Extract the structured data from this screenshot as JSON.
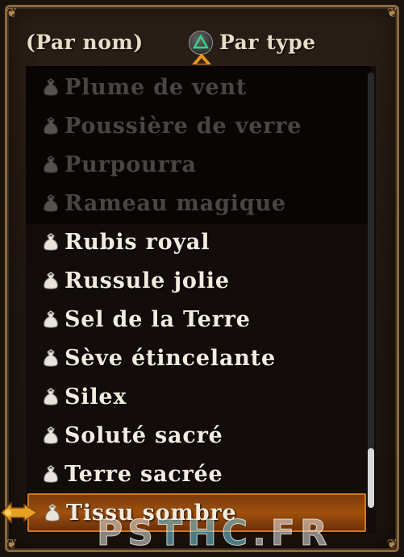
{
  "header": {
    "sort_by_name": "(Par nom)",
    "sort_by_type": "Par type",
    "button_icon": "triangle-button-icon"
  },
  "items": [
    {
      "label": "Plume de vent",
      "state": "dim"
    },
    {
      "label": "Poussière de verre",
      "state": "dim"
    },
    {
      "label": "Purpourra",
      "state": "dim"
    },
    {
      "label": "Rameau magique",
      "state": "dim"
    },
    {
      "label": "Rubis royal",
      "state": "normal"
    },
    {
      "label": "Russule jolie",
      "state": "normal"
    },
    {
      "label": "Sel de la Terre",
      "state": "normal"
    },
    {
      "label": "Sève étincelante",
      "state": "normal"
    },
    {
      "label": "Silex",
      "state": "normal"
    },
    {
      "label": "Soluté sacré",
      "state": "normal"
    },
    {
      "label": "Terre sacrée",
      "state": "normal"
    },
    {
      "label": "Tissu sombre",
      "state": "selected"
    }
  ],
  "watermark": {
    "left": "PS",
    "mid": "THC",
    "right": ".FR"
  },
  "colors": {
    "accent": "#e8941c",
    "selection": "#a0500e",
    "frame": "#8a6a3a",
    "text": "#f2ece0"
  }
}
